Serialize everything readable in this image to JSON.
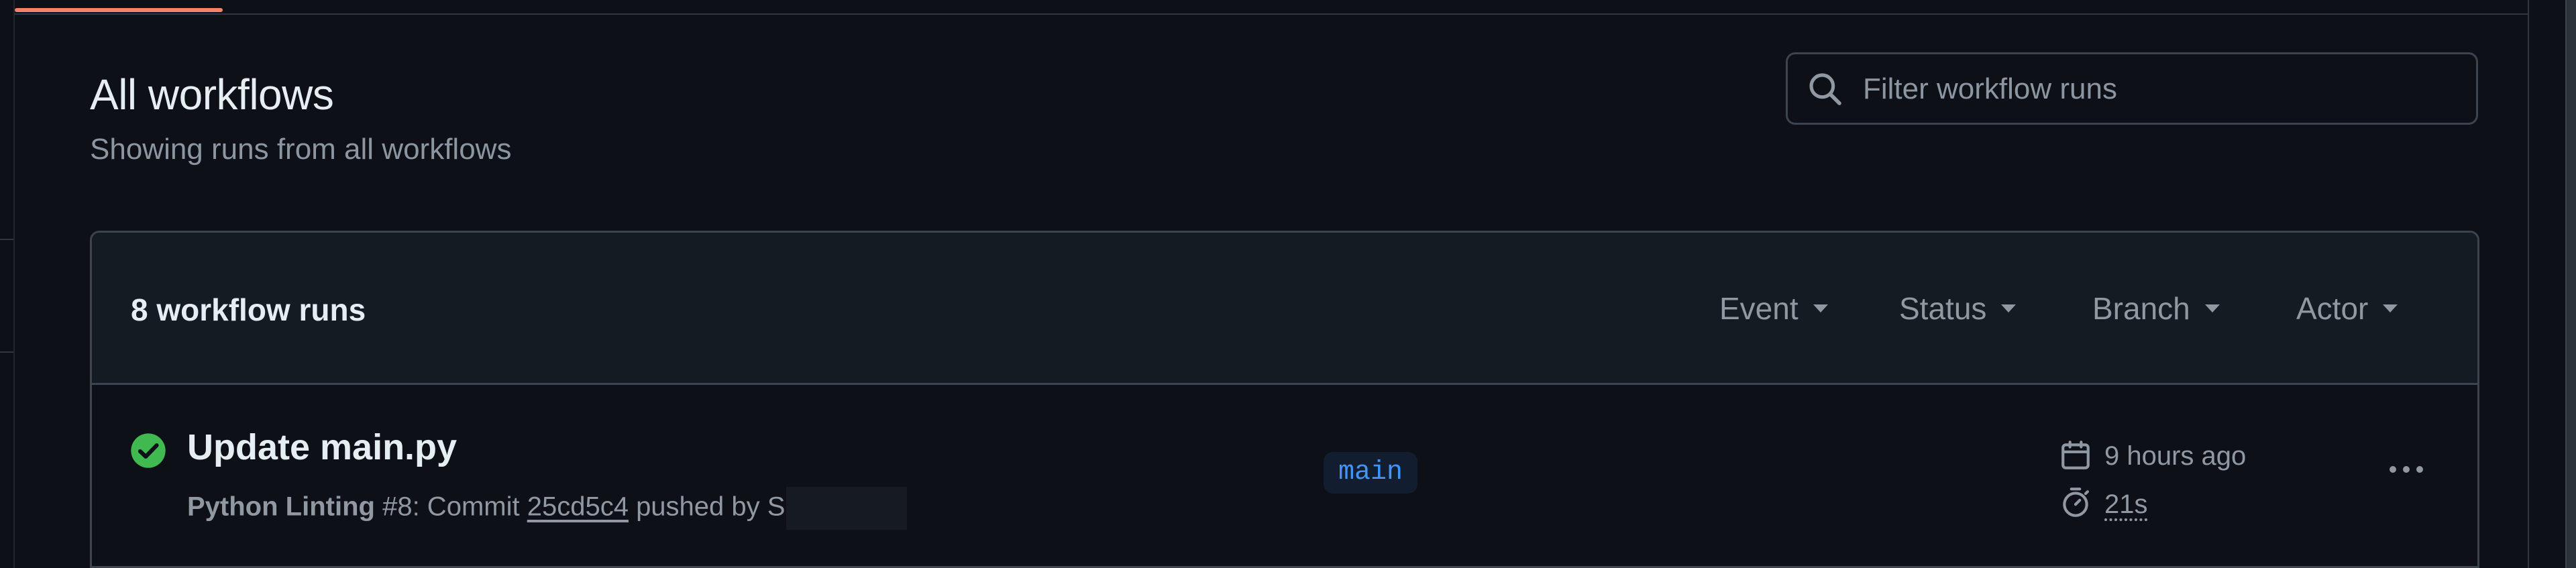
{
  "header": {
    "title": "All workflows",
    "subtitle": "Showing runs from all workflows"
  },
  "search": {
    "placeholder": "Filter workflow runs",
    "value": ""
  },
  "runs_panel": {
    "count_label": "8 workflow runs",
    "filters": [
      {
        "label": "Event"
      },
      {
        "label": "Status"
      },
      {
        "label": "Branch"
      },
      {
        "label": "Actor"
      }
    ]
  },
  "runs": [
    {
      "status": "success",
      "title": "Update main.py",
      "workflow_name": "Python Linting",
      "run_number": "#8",
      "commit_prefix": ": Commit",
      "commit_sha": "25cd5c4",
      "pushed_by_prefix": "pushed by",
      "actor_visible": "S",
      "branch": "main",
      "time_ago": "9 hours ago",
      "duration": "21s"
    }
  ],
  "colors": {
    "background": "#0d1117",
    "success": "#3fb950",
    "branch_text": "#4493f8",
    "active_tab": "#f78166"
  }
}
